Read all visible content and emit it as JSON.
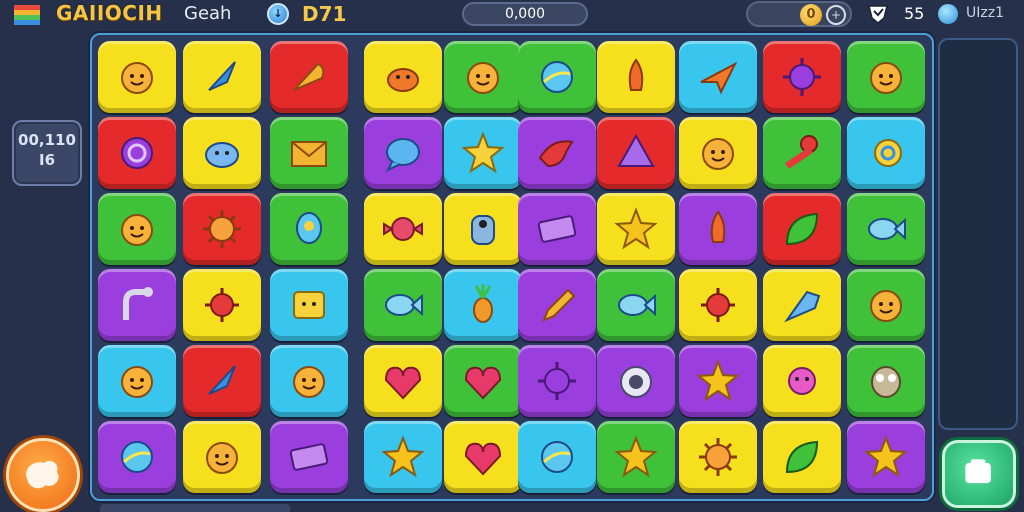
{
  "header": {
    "title": "GAIIOCIH",
    "subtitle": "Geah",
    "level_value": "D71",
    "score": "0,000",
    "coin_count": "0",
    "gem_value": "55",
    "user_label": "UIzz1"
  },
  "left_panel": {
    "line1": "00,110",
    "line2": "I6"
  },
  "colors": {
    "yellow": "#f6df1c",
    "red": "#e42a2a",
    "green": "#3fc13a",
    "blue": "#38c6ee",
    "purple": "#9a3fdd"
  },
  "board": {
    "rows": [
      [
        {
          "color": "yellow",
          "icon": "smiley-face-icon"
        },
        {
          "color": "yellow",
          "icon": "blue-arrow-icon"
        },
        {
          "color": "red",
          "icon": "shell-icon"
        },
        {
          "color": "yellow",
          "icon": "crab-icon"
        },
        {
          "color": "green",
          "icon": "smiley-face-icon"
        },
        {
          "color": "green",
          "icon": "ball-icon"
        },
        {
          "color": "yellow",
          "icon": "rocket-icon"
        },
        {
          "color": "blue",
          "icon": "paper-plane-icon"
        },
        {
          "color": "red",
          "icon": "virus-icon"
        },
        {
          "color": "green",
          "icon": "smiley-face-icon"
        }
      ],
      [
        {
          "color": "red",
          "icon": "spiral-icon"
        },
        {
          "color": "yellow",
          "icon": "blue-blob-icon"
        },
        {
          "color": "green",
          "icon": "envelope-icon"
        },
        {
          "color": "purple",
          "icon": "chat-bubble-icon"
        },
        {
          "color": "blue",
          "icon": "star-creature-icon"
        },
        {
          "color": "purple",
          "icon": "bird-icon"
        },
        {
          "color": "red",
          "icon": "pyramid-icon"
        },
        {
          "color": "yellow",
          "icon": "smiley-face-icon"
        },
        {
          "color": "green",
          "icon": "cherry-icon"
        },
        {
          "color": "blue",
          "icon": "snail-icon"
        }
      ],
      [
        {
          "color": "green",
          "icon": "smiley-face-icon"
        },
        {
          "color": "red",
          "icon": "sun-icon"
        },
        {
          "color": "green",
          "icon": "alien-icon"
        },
        {
          "color": "yellow",
          "icon": "candy-icon"
        },
        {
          "color": "yellow",
          "icon": "robot-icon"
        },
        {
          "color": "purple",
          "icon": "ticket-icon"
        },
        {
          "color": "yellow",
          "icon": "star-icon"
        },
        {
          "color": "purple",
          "icon": "rocket-icon"
        },
        {
          "color": "red",
          "icon": "leaf-icon"
        },
        {
          "color": "green",
          "icon": "fish-icon"
        }
      ],
      [
        {
          "color": "purple",
          "icon": "hook-icon"
        },
        {
          "color": "yellow",
          "icon": "spiky-ball-icon"
        },
        {
          "color": "blue",
          "icon": "square-face-icon"
        },
        {
          "color": "green",
          "icon": "fish-icon"
        },
        {
          "color": "blue",
          "icon": "pineapple-icon"
        },
        {
          "color": "purple",
          "icon": "pencil-icon"
        },
        {
          "color": "green",
          "icon": "fish-icon"
        },
        {
          "color": "yellow",
          "icon": "spiky-ball-icon"
        },
        {
          "color": "yellow",
          "icon": "kite-icon"
        },
        {
          "color": "green",
          "icon": "smiley-face-icon"
        }
      ],
      [
        {
          "color": "blue",
          "icon": "smiley-face-icon"
        },
        {
          "color": "red",
          "icon": "blue-arrow-icon"
        },
        {
          "color": "blue",
          "icon": "smiley-face-icon"
        },
        {
          "color": "yellow",
          "icon": "heart-icon"
        },
        {
          "color": "green",
          "icon": "heart-icon"
        },
        {
          "color": "purple",
          "icon": "virus-icon"
        },
        {
          "color": "purple",
          "icon": "eye-icon"
        },
        {
          "color": "purple",
          "icon": "star-icon"
        },
        {
          "color": "yellow",
          "icon": "monster-icon"
        },
        {
          "color": "green",
          "icon": "owl-icon"
        }
      ],
      [
        {
          "color": "purple",
          "icon": "ball-icon"
        },
        {
          "color": "yellow",
          "icon": "face-icon"
        },
        {
          "color": "purple",
          "icon": "ticket-icon"
        },
        {
          "color": "blue",
          "icon": "star-icon"
        },
        {
          "color": "yellow",
          "icon": "heart-icon"
        },
        {
          "color": "blue",
          "icon": "ball-icon"
        },
        {
          "color": "green",
          "icon": "star-icon"
        },
        {
          "color": "yellow",
          "icon": "sun-icon"
        },
        {
          "color": "yellow",
          "icon": "leaf-icon"
        },
        {
          "color": "purple",
          "icon": "star-icon"
        }
      ]
    ]
  }
}
